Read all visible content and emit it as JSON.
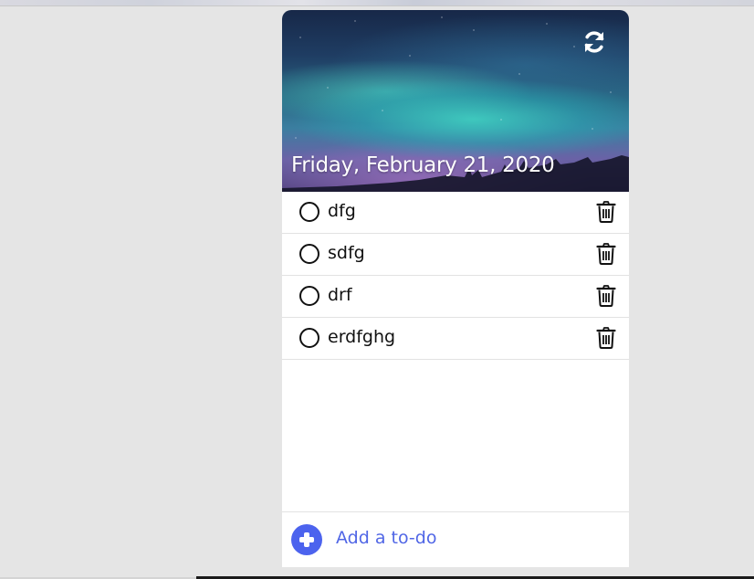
{
  "header": {
    "date": "Friday, February 21, 2020",
    "refresh_icon": "refresh-icon"
  },
  "todos": [
    {
      "text": "dfg",
      "done": false
    },
    {
      "text": "sdfg",
      "done": false
    },
    {
      "text": "drf",
      "done": false
    },
    {
      "text": "erdfghg",
      "done": false
    }
  ],
  "footer": {
    "add_label": "Add a to-do",
    "add_icon": "plus-circle-icon"
  },
  "colors": {
    "accent": "#4c63ee",
    "add_text": "#5066e6",
    "background": "#e5e5e5"
  }
}
